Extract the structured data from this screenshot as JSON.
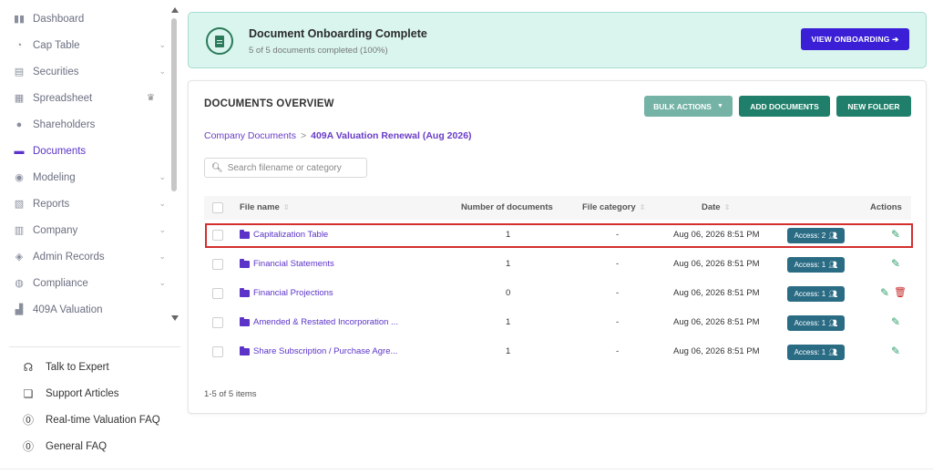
{
  "sidebar": {
    "items": [
      {
        "label": "Dashboard",
        "icon": "dashboard-icon",
        "glyph": "▮▮",
        "chevron": false
      },
      {
        "label": "Cap Table",
        "icon": "pie-chart-icon",
        "glyph": "◔",
        "chevron": true
      },
      {
        "label": "Securities",
        "icon": "clipboard-icon",
        "glyph": "▤",
        "chevron": true
      },
      {
        "label": "Spreadsheet",
        "icon": "grid-icon",
        "glyph": "▦",
        "chevron": false,
        "crown": true
      },
      {
        "label": "Shareholders",
        "icon": "user-icon",
        "glyph": "●",
        "chevron": false
      },
      {
        "label": "Documents",
        "icon": "folder-icon",
        "glyph": "▬",
        "chevron": false,
        "active": true
      },
      {
        "label": "Modeling",
        "icon": "bulb-icon",
        "glyph": "◉",
        "chevron": true
      },
      {
        "label": "Reports",
        "icon": "report-icon",
        "glyph": "▧",
        "chevron": true
      },
      {
        "label": "Company",
        "icon": "building-icon",
        "glyph": "▥",
        "chevron": true
      },
      {
        "label": "Admin Records",
        "icon": "key-icon",
        "glyph": "◈",
        "chevron": true
      },
      {
        "label": "Compliance",
        "icon": "shield-icon",
        "glyph": "◍",
        "chevron": true
      },
      {
        "label": "409A Valuation",
        "icon": "bar-chart-icon",
        "glyph": "▟",
        "chevron": false
      }
    ],
    "help": [
      {
        "label": "Talk to Expert",
        "icon": "headset-icon",
        "glyph": "☊"
      },
      {
        "label": "Support Articles",
        "icon": "book-icon",
        "glyph": "❏"
      },
      {
        "label": "Real-time Valuation FAQ",
        "icon": "question-icon",
        "glyph": "⓪"
      },
      {
        "label": "General FAQ",
        "icon": "question-icon",
        "glyph": "⓪"
      }
    ]
  },
  "banner": {
    "title": "Document Onboarding Complete",
    "subtitle": "5 of 5 documents completed (100%)",
    "button": "VIEW ONBOARDING ➔"
  },
  "documents": {
    "title": "DOCUMENTS OVERVIEW",
    "bulk_actions": "BULK ACTIONS",
    "add_documents": "ADD DOCUMENTS",
    "new_folder": "NEW FOLDER",
    "breadcrumb_root": "Company Documents",
    "breadcrumb_sep": ">",
    "breadcrumb_current": "409A Valuation Renewal (Aug 2026)",
    "search_placeholder": "Search filename or category",
    "columns": {
      "file_name": "File name",
      "number": "Number of documents",
      "category": "File category",
      "date": "Date",
      "actions": "Actions"
    },
    "rows": [
      {
        "name": "Capitalization Table",
        "count": "1",
        "category": "-",
        "date": "Aug 06, 2026 8:51 PM",
        "access": "Access: 2",
        "delete": false
      },
      {
        "name": "Financial Statements",
        "count": "1",
        "category": "-",
        "date": "Aug 06, 2026 8:51 PM",
        "access": "Access: 1",
        "delete": false
      },
      {
        "name": "Financial Projections",
        "count": "0",
        "category": "-",
        "date": "Aug 06, 2026 8:51 PM",
        "access": "Access: 1",
        "delete": true
      },
      {
        "name": "Amended & Restated Incorporation ...",
        "count": "1",
        "category": "-",
        "date": "Aug 06, 2026 8:51 PM",
        "access": "Access: 1",
        "delete": false
      },
      {
        "name": "Share Subscription / Purchase Agre...",
        "count": "1",
        "category": "-",
        "date": "Aug 06, 2026 8:51 PM",
        "access": "Access: 1",
        "delete": false
      }
    ],
    "footer": "1-5 of 5 items"
  },
  "colors": {
    "accent_purple": "#5b33c8",
    "button_green": "#1f7f6a",
    "banner_bg": "#d9f5ee",
    "access_badge": "#2b6c85",
    "highlight": "#d32f2f"
  }
}
